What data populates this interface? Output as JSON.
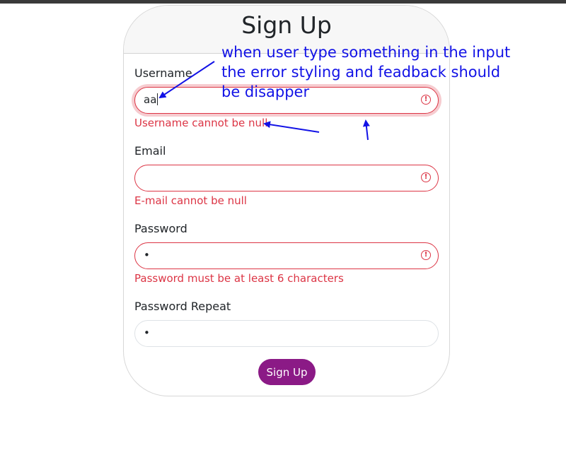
{
  "form": {
    "title": "Sign Up",
    "fields": {
      "username": {
        "label": "Username",
        "value": "aa",
        "feedback": "Username cannot be null",
        "state": "invalid"
      },
      "email": {
        "label": "Email",
        "value": "",
        "feedback": "E-mail cannot be null",
        "state": "invalid"
      },
      "password": {
        "label": "Password",
        "value": "•",
        "feedback": "Password must be at least 6 characters",
        "state": "invalid"
      },
      "password_repeat": {
        "label": "Password Repeat",
        "value": "•",
        "feedback": "",
        "state": "normal"
      }
    },
    "submit_label": "Sign Up",
    "error_icon": "exclamation-circle-icon"
  },
  "annotation": {
    "lines": [
      "when user type something in the input",
      "the error styling and feadback should",
      "be disapper"
    ],
    "color": "#1212e6"
  },
  "colors": {
    "error": "#dc3545",
    "button": "#8b1a86",
    "header_bg": "#f7f7f7"
  }
}
